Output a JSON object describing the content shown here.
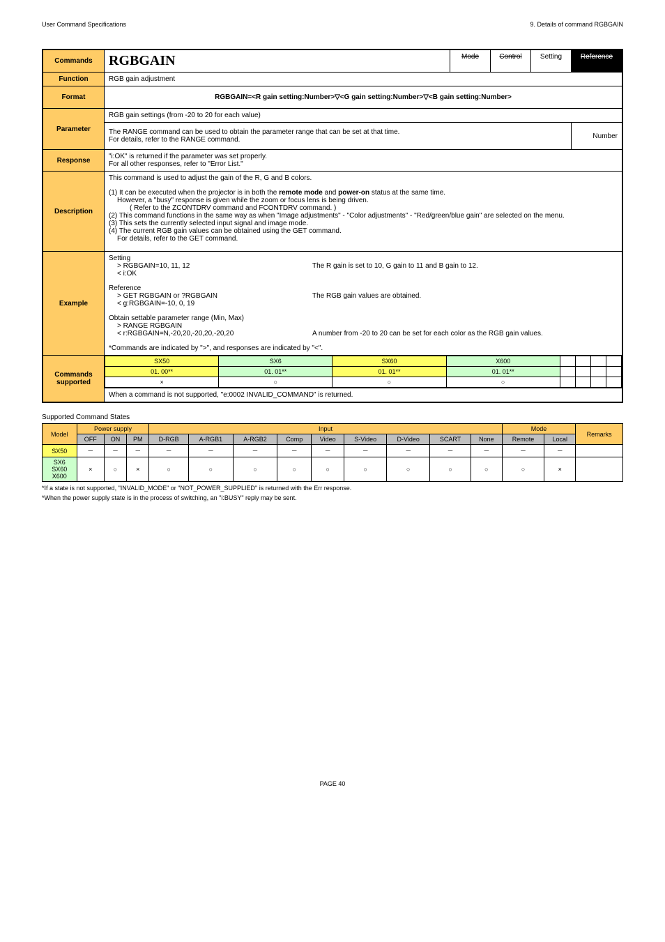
{
  "header": {
    "left": "User Command Specifications",
    "right": "9. Details of command RGBGAIN"
  },
  "rows": {
    "commands_label": "Commands",
    "command_name": "RGBGAIN",
    "mode_labels": [
      "Mode",
      "Control",
      "Setting",
      "Reference"
    ],
    "function_label": "Function",
    "function_text": "RGB gain adjustment",
    "format_label": "Format",
    "format_text": "RGBGAIN=<R gain setting:Number>▽<G gain setting:Number>▽<B gain setting:Number>",
    "parameter_label": "Parameter",
    "parameter_l1": "RGB gain settings (from -20 to 20 for each value)",
    "parameter_l2": "The RANGE command can be used to obtain the parameter range that can be set at that time.",
    "parameter_l3": "For details, refer to the RANGE command.",
    "parameter_number": "Number",
    "response_label": "Response",
    "response_l1": "\"i:OK\" is returned if the parameter was set properly.",
    "response_l2": "For all other responses, refer to \"Error List.\"",
    "description_label": "Description",
    "description_l1": "This command is used to adjust the gain of the R, G and B colors.",
    "description_p1a": "(1)",
    "description_p1b": "It can be executed when the projector is in both the remote mode and power-on status at the same time.",
    "description_p1c": "However, a \"busy\" response is given while the zoom or focus lens is being driven.",
    "description_p1d": "( Refer to the ZCONTDRV command and FCONTDRV command. )",
    "description_p2a": "(2)",
    "description_p2b": "This command functions in the same way as when \"Image adjustments\" - \"Color adjustments\" - \"Red/green/blue gain\" are selected on the menu.",
    "description_p3a": "(3)",
    "description_p3b": "This sets the currently selected input signal and image mode.",
    "description_p4a": "(4)",
    "description_p4b": "The current RGB gain values can be obtained using the GET command.",
    "description_p4c": "For details, refer to the GET command.",
    "example_label": "Example",
    "ex_setting": "Setting",
    "ex_s1": "> RGBGAIN=10, 11, 12",
    "ex_s1r": "The R gain is set to 10, G gain to 11 and B gain to 12.",
    "ex_s2": "< i:OK",
    "ex_reference": "Reference",
    "ex_r1": "> GET RGBGAIN or ?RGBGAIN",
    "ex_r1r": "The RGB gain values are obtained.",
    "ex_r2": "< g:RGBGAIN=-10, 0, 19",
    "ex_obtain": "Obtain settable parameter range (Min, Max)",
    "ex_o1": "> RANGE RGBGAIN",
    "ex_o2": "< r:RGBGAIN=N,-20,20,-20,20,-20,20",
    "ex_o2r": "A number from -20 to 20 can be set for each color as the RGB gain values.",
    "ex_note": "*Commands are indicated by \">\", and responses are indicated by \"<\".",
    "supported_label": "Commands supported",
    "models": [
      "SX50",
      "SX6",
      "SX60",
      "X600"
    ],
    "versions": [
      "01. 00**",
      "01. 01**",
      "01. 01**",
      "01. 01**"
    ],
    "marks": [
      "×",
      "○",
      "○",
      "○"
    ],
    "supported_note": "When a command is not supported, \"e:0002 INVALID_COMMAND\" is returned."
  },
  "states": {
    "title": "Supported Command States",
    "headers1": [
      "Model",
      "Power supply",
      "Input",
      "Mode",
      "Remarks"
    ],
    "headers2": [
      "OFF",
      "ON",
      "PM",
      "D-RGB",
      "A-RGB1",
      "A-RGB2",
      "Comp",
      "Video",
      "S-Video",
      "D-Video",
      "SCART",
      "None",
      "Remote",
      "Local"
    ],
    "row1_model": "SX50",
    "row1": [
      "－",
      "－",
      "－",
      "－",
      "－",
      "－",
      "－",
      "－",
      "－",
      "－",
      "－",
      "－",
      "－",
      "－",
      ""
    ],
    "row2_models": "SX6 SX60 X600",
    "row2": [
      "×",
      "○",
      "×",
      "○",
      "○",
      "○",
      "○",
      "○",
      "○",
      "○",
      "○",
      "○",
      "○",
      "×",
      ""
    ],
    "foot1": "*If a state is not supported, \"INVALID_MODE\" or \"NOT_POWER_SUPPLIED\" is returned with the Err response.",
    "foot2": "*When the power supply state is in the process of switching, an \"i:BUSY\" reply may be sent."
  },
  "footer": "PAGE 40"
}
